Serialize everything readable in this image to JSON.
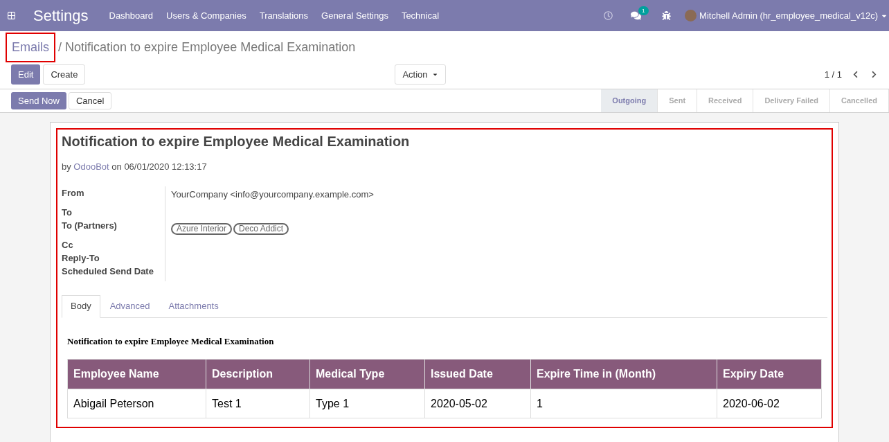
{
  "navbar": {
    "app_title": "Settings",
    "menu": [
      "Dashboard",
      "Users & Companies",
      "Translations",
      "General Settings",
      "Technical"
    ],
    "messages_badge": "1",
    "user": "Mitchell Admin (hr_employee_medical_v12c)"
  },
  "breadcrumb": {
    "parent": "Emails",
    "separator": "/",
    "current": "Notification to expire Employee Medical Examination",
    "highlighted": true
  },
  "control_buttons": [
    "Edit",
    "Create"
  ],
  "action_button": "Action",
  "pager": "1 / 1",
  "status_buttons": [
    "Send Now",
    "Cancel"
  ],
  "status_steps": [
    {
      "label": "Outgoing",
      "selected": true
    },
    {
      "label": "Sent",
      "selected": false
    },
    {
      "label": "Received",
      "selected": false
    },
    {
      "label": "Delivery Failed",
      "selected": false
    },
    {
      "label": "Cancelled",
      "selected": false
    }
  ],
  "mail": {
    "highlighted": true,
    "subject": "Notification to expire Employee Medical Examination",
    "by_prefix": "by",
    "author": "OdooBot",
    "date_text": "on 06/01/2020 12:13:17",
    "fields": [
      {
        "label": "From",
        "kind": "text",
        "value": "YourCompany <info@yourcompany.example.com>"
      },
      {
        "label": "To",
        "kind": "empty"
      },
      {
        "label": "To (Partners)",
        "kind": "tags",
        "tags": [
          "Azure Interior",
          "Deco Addict"
        ]
      },
      {
        "label": "Cc",
        "kind": "empty"
      },
      {
        "label": "Reply-To",
        "kind": "empty"
      },
      {
        "label": "Scheduled Send Date",
        "kind": "empty"
      }
    ],
    "tabs": [
      {
        "label": "Body",
        "selected": true
      },
      {
        "label": "Advanced",
        "selected": false
      },
      {
        "label": "Attachments",
        "selected": false
      }
    ],
    "body_heading": "Notification to expire Employee Medical Examination",
    "table": {
      "columns": [
        "Employee Name",
        "Description",
        "Medical Type",
        "Issued Date",
        "Expire Time in (Month)",
        "Expiry Date"
      ],
      "rows": [
        [
          "Abigail Peterson",
          "Test 1",
          "Type 1",
          "2020-05-02",
          "1",
          "2020-06-02"
        ]
      ]
    }
  }
}
